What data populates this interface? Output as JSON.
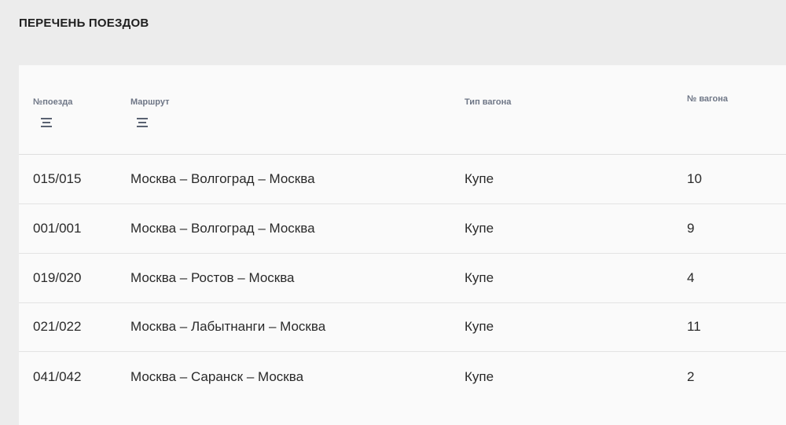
{
  "page": {
    "title": "ПЕРЕЧЕНЬ ПОЕЗДОВ"
  },
  "table": {
    "columns": [
      {
        "label": "№поезда",
        "sortable": true
      },
      {
        "label": "Маршрут",
        "sortable": true
      },
      {
        "label": "Тип вагона",
        "sortable": false
      },
      {
        "label": "№ вагона",
        "sortable": false
      }
    ],
    "rows": [
      {
        "train": "015/015",
        "route": "Москва – Волгоград – Москва",
        "car_type": "Купе",
        "car_no": "10"
      },
      {
        "train": "001/001",
        "route": "Москва – Волгоград – Москва",
        "car_type": "Купе",
        "car_no": "9"
      },
      {
        "train": "019/020",
        "route": "Москва – Ростов – Москва",
        "car_type": "Купе",
        "car_no": "4"
      },
      {
        "train": "021/022",
        "route": "Москва – Лабытнанги – Москва",
        "car_type": "Купе",
        "car_no": "11"
      },
      {
        "train": "041/042",
        "route": "Москва – Саранск – Москва",
        "car_type": "Купе",
        "car_no": "2"
      }
    ]
  },
  "icons": {
    "sort": "sort-lines-icon"
  },
  "colors": {
    "page_background": "#ececec",
    "card_background": "#fafafa",
    "header_text": "#6e7686",
    "divider": "#e3e3e3"
  }
}
